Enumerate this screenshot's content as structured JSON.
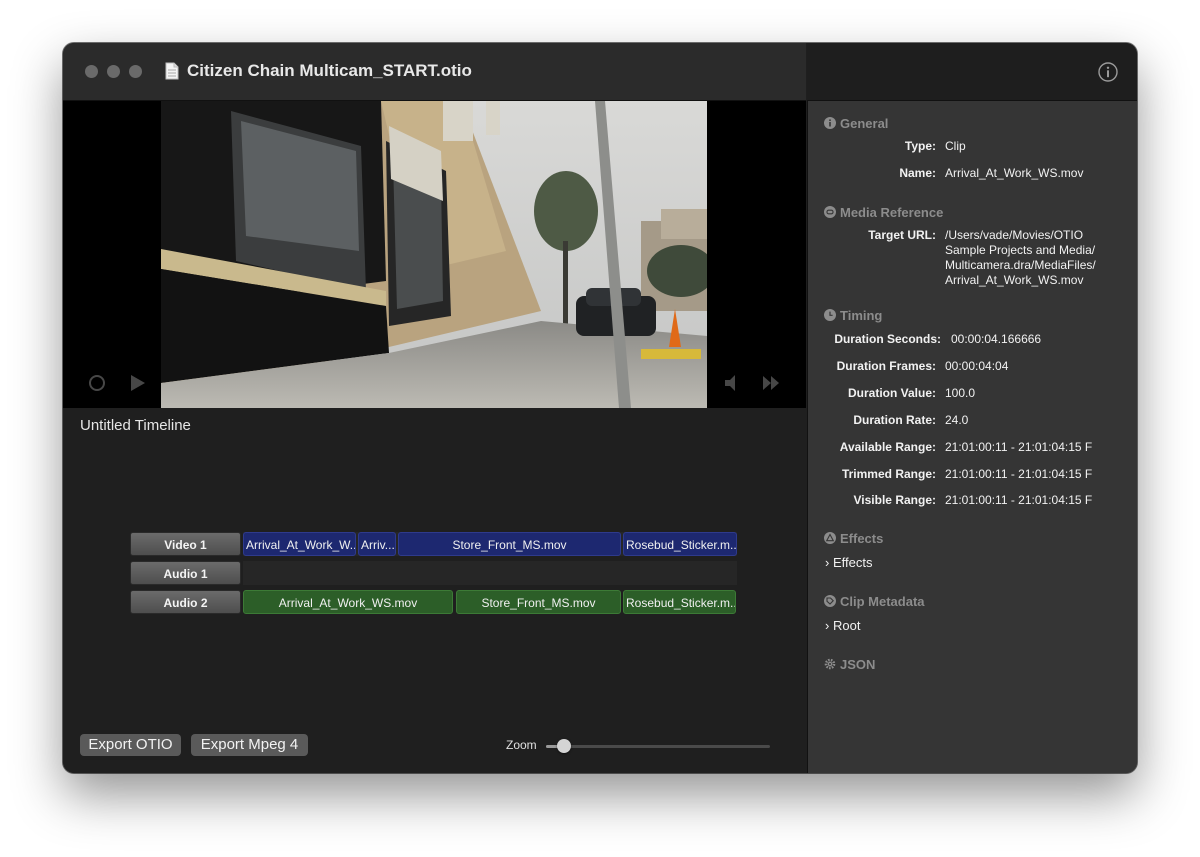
{
  "window": {
    "title": "Citizen Chain Multicam_START.otio"
  },
  "timeline": {
    "name": "Untitled Timeline",
    "tracks": [
      {
        "name": "Video 1",
        "kind": "video",
        "clips": [
          {
            "label": "Arrival_At_Work_W..."
          },
          {
            "label": "Arriv..."
          },
          {
            "label": "Store_Front_MS.mov"
          },
          {
            "label": "Rosebud_Sticker.m..."
          }
        ]
      },
      {
        "name": "Audio 1",
        "kind": "audio",
        "clips": []
      },
      {
        "name": "Audio 2",
        "kind": "audio",
        "clips": [
          {
            "label": "Arrival_At_Work_WS.mov"
          },
          {
            "label": "Store_Front_MS.mov"
          },
          {
            "label": "Rosebud_Sticker.m..."
          }
        ]
      }
    ]
  },
  "footer": {
    "export_otio": "Export OTIO",
    "export_mpeg4": "Export Mpeg 4",
    "zoom_label": "Zoom",
    "zoom_level": 0.08
  },
  "inspector": {
    "general": {
      "title": "General",
      "type_label": "Type:",
      "type_value": "Clip",
      "name_label": "Name:",
      "name_value": "Arrival_At_Work_WS.mov"
    },
    "media_reference": {
      "title": "Media Reference",
      "target_url_label": "Target URL:",
      "target_url_lines": [
        "/Users/vade/Movies/OTIO",
        "Sample Projects and Media/",
        "Multicamera.dra/MediaFiles/",
        "Arrival_At_Work_WS.mov"
      ]
    },
    "timing": {
      "title": "Timing",
      "duration_seconds_label": "Duration Seconds:",
      "duration_seconds": "00:00:04.166666",
      "duration_frames_label": "Duration Frames:",
      "duration_frames": "00:00:04:04",
      "duration_value_label": "Duration Value:",
      "duration_value": "100.0",
      "duration_rate_label": "Duration Rate:",
      "duration_rate": "24.0",
      "available_range_label": "Available Range:",
      "available_range": "21:01:00:11 - 21:01:04:15 F",
      "trimmed_range_label": "Trimmed Range:",
      "trimmed_range": "21:01:00:11 - 21:01:04:15 F",
      "visible_range_label": "Visible Range:",
      "visible_range": "21:01:00:11 - 21:01:04:15 F"
    },
    "effects": {
      "title": "Effects",
      "item": "Effects"
    },
    "clip_metadata": {
      "title": "Clip Metadata",
      "item": "Root"
    },
    "json": {
      "title": "JSON"
    }
  },
  "colors": {
    "video_clip": "#1d2870",
    "audio_clip": "#2c5e28",
    "sidebar": "#353535",
    "panel": "#1f1f1f"
  }
}
